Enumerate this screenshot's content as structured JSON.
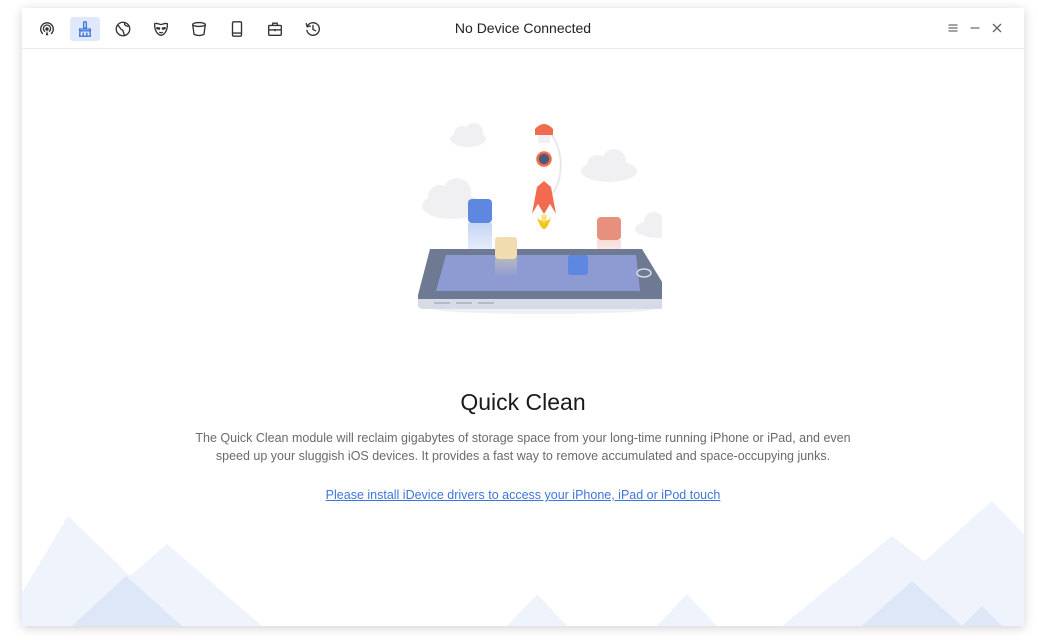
{
  "window": {
    "title": "No Device Connected"
  },
  "toolbar": {
    "items": [
      {
        "name": "airdrop-icon",
        "active": false
      },
      {
        "name": "broom-clean-icon",
        "active": true
      },
      {
        "name": "globe-privacy-icon",
        "active": false
      },
      {
        "name": "mask-icon",
        "active": false
      },
      {
        "name": "bucket-icon",
        "active": false
      },
      {
        "name": "phone-icon",
        "active": false
      },
      {
        "name": "toolbox-icon",
        "active": false
      },
      {
        "name": "history-icon",
        "active": false
      }
    ],
    "active_color": "#dfe9fb",
    "icon_color": "#333333",
    "active_icon_color": "#3f75d9"
  },
  "window_controls": {
    "icons": [
      "menu-icon",
      "minimize-icon",
      "close-icon"
    ]
  },
  "feature": {
    "title": "Quick Clean",
    "description": "The Quick Clean module will reclaim gigabytes of storage space from your long-time running iPhone or iPad, and even speed up your sluggish iOS devices. It provides a fast way to remove accumulated and space-occupying junks.",
    "link_text": "Please install iDevice drivers to access your iPhone, iPad or iPod touch"
  },
  "colors": {
    "link": "#3f75d9",
    "mountain_light": "#eef3fc",
    "mountain_dark": "#dde7f8",
    "rocket": "#f26b4f",
    "flame": "#f5c518",
    "phone_body": "#6e7a93",
    "phone_screen": "#8e9bd2"
  }
}
